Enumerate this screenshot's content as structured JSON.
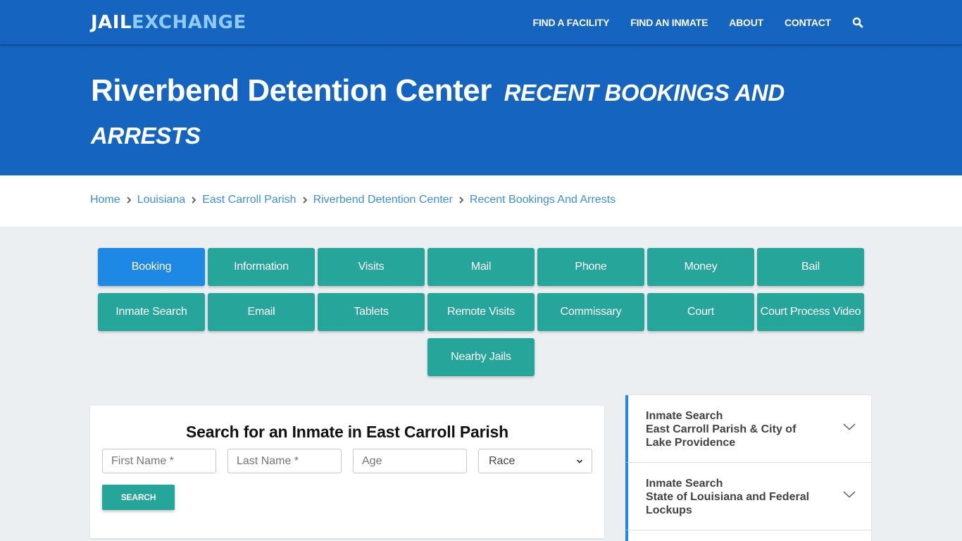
{
  "navbar": {
    "logo_part1": "JAIL",
    "logo_part2": "EXCHANGE",
    "links": [
      "FIND A FACILITY",
      "FIND AN INMATE",
      "ABOUT",
      "CONTACT"
    ],
    "search_icon": "search-icon"
  },
  "hero": {
    "title": "Riverbend Detention Center",
    "subtitle": "RECENT BOOKINGS AND ARRESTS"
  },
  "breadcrumb": {
    "items": [
      "Home",
      "Louisiana",
      "East Carroll Parish",
      "Riverbend Detention Center",
      "Recent Bookings And Arrests"
    ],
    "separator_icon": "chevron-right-icon"
  },
  "tiles": {
    "active": "Booking",
    "items": [
      "Booking",
      "Information",
      "Visits",
      "Mail",
      "Phone",
      "Money",
      "Bail",
      "Inmate Search",
      "Email",
      "Tablets",
      "Remote Visits",
      "Commissary",
      "Court",
      "Court Process Video",
      "Nearby Jails"
    ]
  },
  "search": {
    "title": "Search for an Inmate in East Carroll Parish",
    "first_name_placeholder": "First Name *",
    "last_name_placeholder": "Last Name *",
    "age_placeholder": "Age",
    "race_selected": "Race",
    "button_label": "SEARCH"
  },
  "sidebar": {
    "items": [
      {
        "title": "Inmate Search",
        "subtitle": "East Carroll Parish & City of Lake Providence"
      },
      {
        "title": "Inmate Search",
        "subtitle": "State of Louisiana and Federal Lockups"
      }
    ]
  },
  "colors": {
    "brand_blue": "#1565c0",
    "logo_accent": "#90caf9",
    "tile_teal": "#26a69a",
    "tile_active": "#1e88e5",
    "link_blue": "#3d8fd9"
  }
}
